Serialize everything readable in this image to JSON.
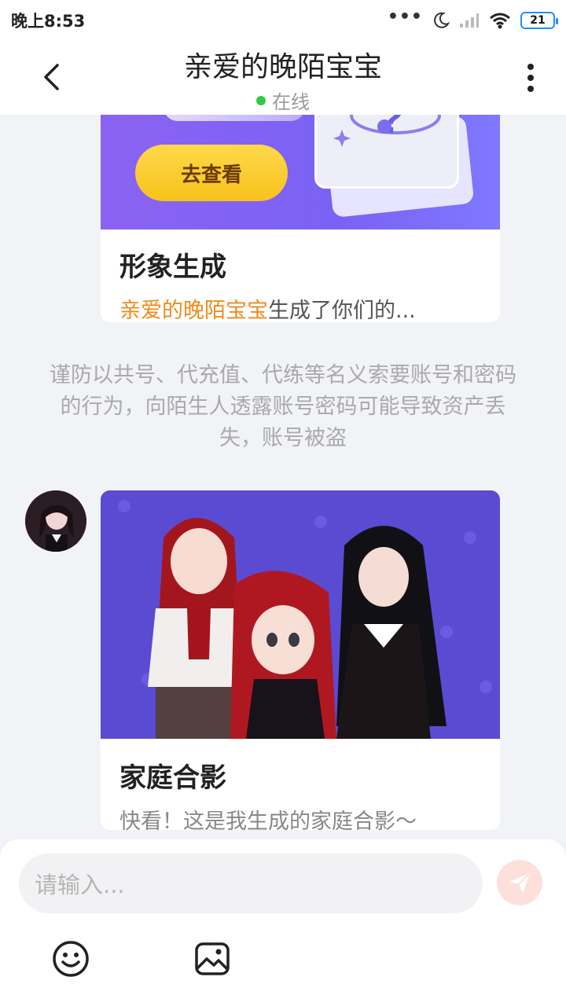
{
  "status_bar": {
    "time": "晚上8:53",
    "dots": "•••",
    "battery": "21"
  },
  "header": {
    "title": "亲爱的晚陌宝宝",
    "status": "在线"
  },
  "messages": {
    "card1": {
      "button_label": "去查看",
      "title": "形象生成",
      "desc_highlight": "亲爱的晚陌宝宝",
      "desc_rest": "生成了你们的..."
    },
    "notice": "谨防以共号、代充值、代练等名义索要账号和密码的行为，向陌生人透露账号密码可能导致资产丢失，账号被盗",
    "card2": {
      "title": "家庭合影",
      "desc": "快看！这是我生成的家庭合影～"
    }
  },
  "input": {
    "placeholder": "请输入..."
  },
  "colors": {
    "accent_orange": "#f08a1c",
    "online_green": "#2ecc40",
    "banner_purple": "#8b63f2",
    "button_yellow": "#f7c21c"
  },
  "icons": [
    "back-arrow-icon",
    "more-vertical-icon",
    "moon-icon",
    "signal-icon",
    "wifi-icon",
    "send-icon",
    "emoji-icon",
    "image-icon",
    "question-planet-icon"
  ]
}
